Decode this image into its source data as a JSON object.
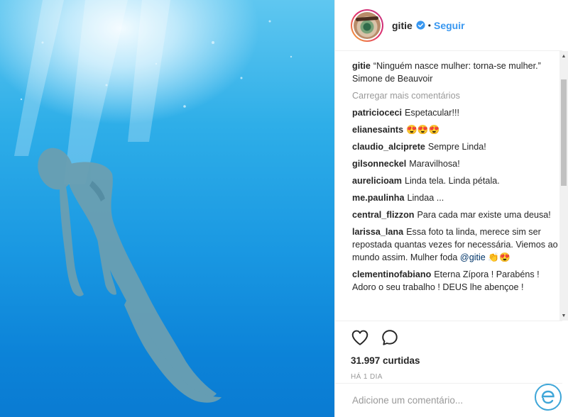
{
  "post": {
    "username": "gitie",
    "follow_label": "Seguir",
    "dot": "•",
    "caption": {
      "user": "gitie",
      "text": "“Ninguém nasce mulher: torna-se mulher.” Simone de Beauvoir"
    },
    "load_more": "Carregar mais comentários",
    "comments": [
      {
        "user": "patricioceci",
        "text": "Espetacular!!!"
      },
      {
        "user": "elianesaints",
        "text": "😍😍😍"
      },
      {
        "user": "claudio_alciprete",
        "text": "Sempre Linda!"
      },
      {
        "user": "gilsonneckel",
        "text": "Maravilhosa!"
      },
      {
        "user": "aurelicioam",
        "text": "Linda tela. Linda pétala."
      },
      {
        "user": "me.paulinha",
        "text": "Lindaa ..."
      },
      {
        "user": "central_flizzon",
        "text": "Para cada mar existe uma deusa!"
      },
      {
        "user": "larissa_lana",
        "text": "Essa foto ta linda, merece sim ser repostada quantas vezes for necessária. Viemos ao mundo assim. Mulher foda",
        "mention": "@gitie",
        "emoji": "👏😍"
      },
      {
        "user": "clementinofabiano",
        "text": "Eterna Zípora ! Parabéns ! Adoro o seu trabalho ! DEUS lhe abençoe !"
      }
    ],
    "likes": "31.997 curtidas",
    "time": "HÁ 1 DIA",
    "comment_placeholder": "Adicione um comentário...",
    "icons": {
      "like": "heart-icon",
      "comment": "comment-icon",
      "verified": "verified-badge-icon"
    }
  },
  "colors": {
    "link": "#3897f0",
    "muted": "#999999",
    "text": "#262626",
    "water": "#1a98e2"
  }
}
